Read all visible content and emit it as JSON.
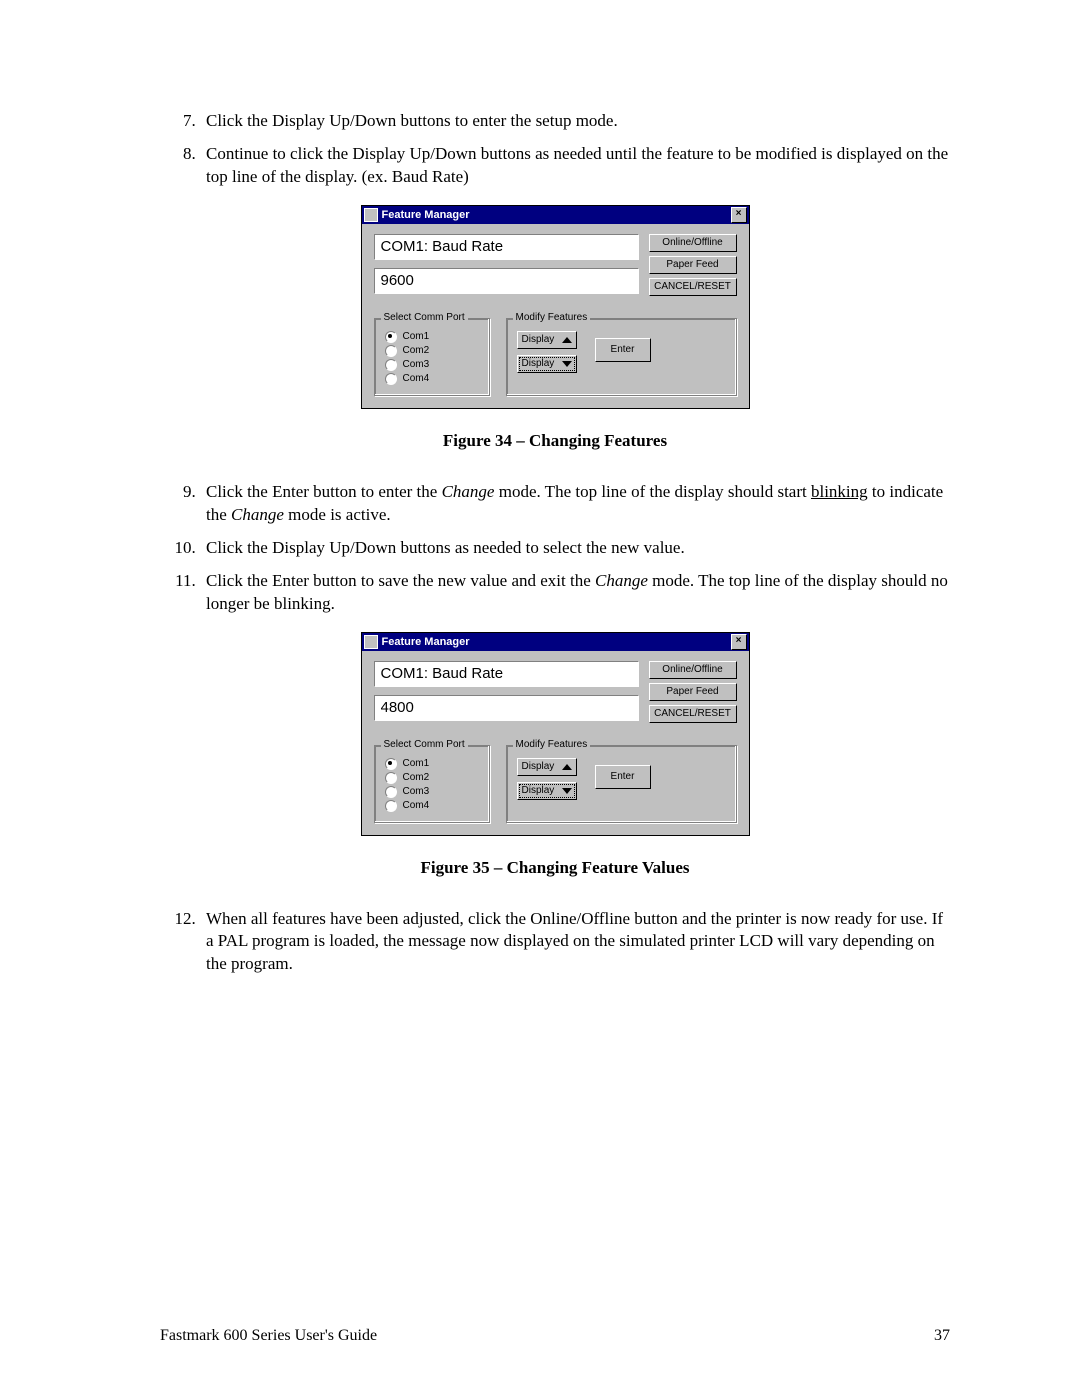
{
  "footer": {
    "title": "Fastmark 600 Series User's Guide",
    "pageNumber": "37"
  },
  "listA": {
    "i7": "Click the Display Up/Down buttons to enter the setup mode.",
    "i8": "Continue to click the Display Up/Down buttons as needed until the feature to be modified is displayed on the top line of the display. (ex. Baud Rate)"
  },
  "listB": {
    "i9a": "Click the Enter button to enter the ",
    "i9b": "Change",
    "i9c": " mode.  The top line of the display should start ",
    "i9d": "blinking",
    "i9e": " to indicate the ",
    "i9f": "Change",
    "i9g": " mode is active.",
    "i10": "Click the Display Up/Down buttons as needed to select the new value.",
    "i11a": "Click the Enter button to save the new value and exit the ",
    "i11b": "Change",
    "i11c": " mode.  The top line of the display should no longer be blinking."
  },
  "listC": {
    "i12": "When all features have been adjusted, click the Online/Offline button and the printer is now ready for use.  If a PAL program is loaded, the message now displayed on the simulated printer LCD will vary depending on the program."
  },
  "fig34": {
    "caption": "Figure 34 – Changing Features"
  },
  "fig35": {
    "caption": "Figure 35 – Changing Feature Values"
  },
  "win": {
    "title": "Feature Manager",
    "btnOnline": "Online/Offline",
    "btnPaper": "Paper Feed",
    "btnCancel": "CANCEL/RESET",
    "grpComm": "Select Comm Port",
    "grpMod": "Modify Features",
    "com1": "Com1",
    "com2": "Com2",
    "com3": "Com3",
    "com4": "Com4",
    "display": "Display",
    "enter": "Enter",
    "close": "×"
  },
  "win1": {
    "line1": "COM1: Baud Rate",
    "line2": "9600"
  },
  "win2": {
    "line1": "COM1: Baud Rate",
    "line2": "4800"
  }
}
